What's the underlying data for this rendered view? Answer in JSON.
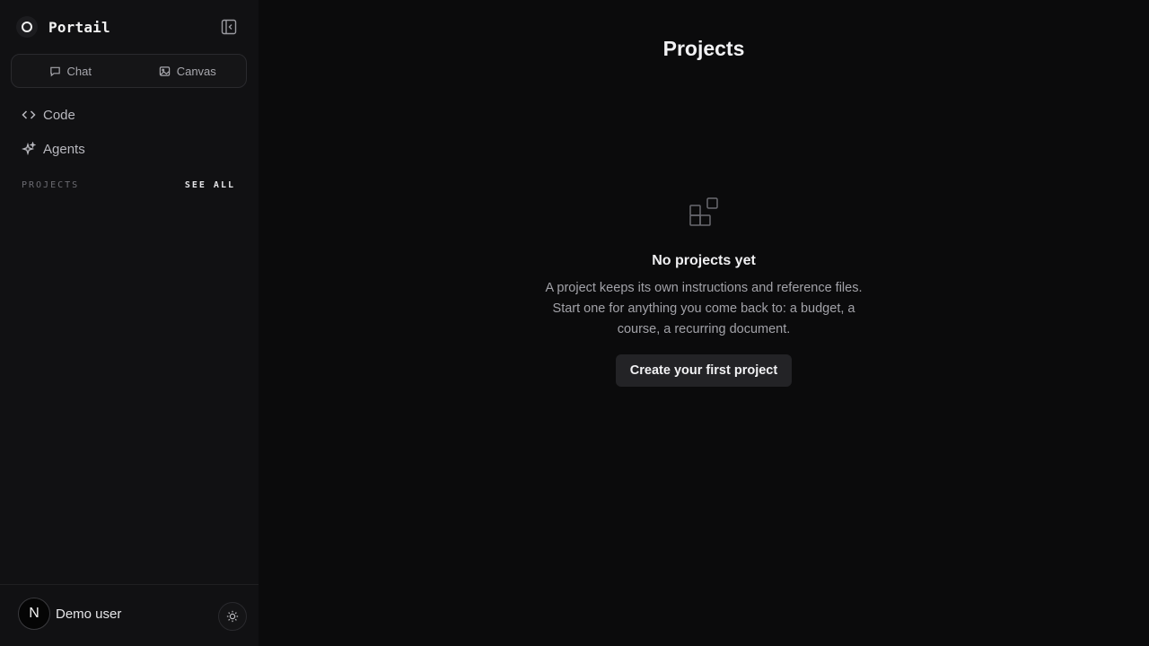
{
  "app": {
    "name": "Portail"
  },
  "sidebar": {
    "modes": [
      {
        "label": "Chat",
        "icon": "chat-bubble-icon"
      },
      {
        "label": "Canvas",
        "icon": "image-icon"
      }
    ],
    "nav": [
      {
        "label": "Code",
        "icon": "code-brackets-icon"
      },
      {
        "label": "Agents",
        "icon": "sparkles-icon"
      }
    ],
    "projects_label": "PROJECTS",
    "see_all_label": "SEE ALL",
    "user": {
      "initial": "N",
      "name": "Demo user"
    }
  },
  "main": {
    "title": "Projects",
    "empty": {
      "title": "No projects yet",
      "description": "A project keeps its own instructions and reference files. Start one for anything you come back to: a budget, a course, a recurring document.",
      "cta": "Create your first project"
    }
  },
  "colors": {
    "background": "#0b0b0c",
    "sidebar": "#111113",
    "button": "#232326",
    "text_muted": "#a2a2a8"
  }
}
